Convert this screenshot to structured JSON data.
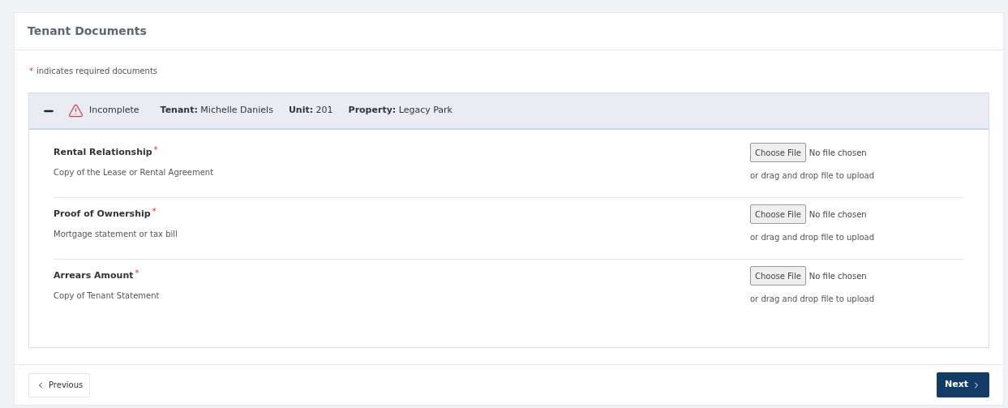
{
  "card": {
    "title": "Tenant Documents"
  },
  "required_note": {
    "marker": "*",
    "text": "indicates required documents"
  },
  "tenant_panel": {
    "expanded": true,
    "status": "Incomplete",
    "fields": [
      {
        "label": "Tenant:",
        "value": "Michelle Daniels"
      },
      {
        "label": "Unit:",
        "value": "201"
      },
      {
        "label": "Property:",
        "value": "Legacy Park"
      }
    ],
    "documents": [
      {
        "title": "Rental Relationship",
        "required": true,
        "description": "Copy of the Lease or Rental Agreement",
        "button": "Choose File",
        "file_status": "No file chosen",
        "hint": "or drag and drop file to upload"
      },
      {
        "title": "Proof of Ownership",
        "required": true,
        "description": "Mortgage statement or tax bill",
        "button": "Choose File",
        "file_status": "No file chosen",
        "hint": "or drag and drop file to upload"
      },
      {
        "title": "Arrears Amount",
        "required": true,
        "description": "Copy of Tenant Statement",
        "button": "Choose File",
        "file_status": "No file chosen",
        "hint": "or drag and drop file to upload"
      }
    ]
  },
  "footer": {
    "previous": "Previous",
    "next": "Next"
  }
}
